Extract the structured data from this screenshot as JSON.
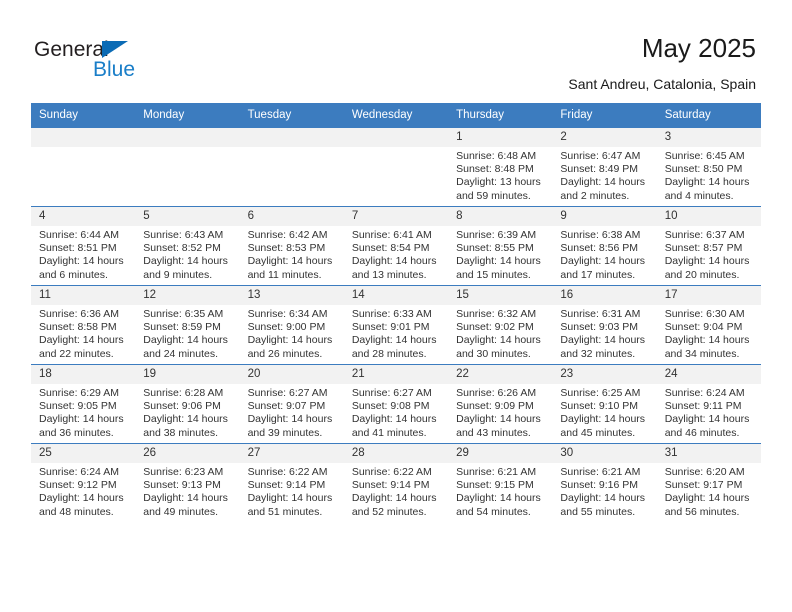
{
  "brand": {
    "name_part1": "General",
    "name_part2": "Blue",
    "triangle_icon": "triangle-icon",
    "accent_color": "#1a7ec8"
  },
  "header": {
    "title": "May 2025",
    "subtitle": "Sant Andreu, Catalonia, Spain",
    "header_bg_color": "#3c7cbf"
  },
  "weekday_headers": [
    "Sunday",
    "Monday",
    "Tuesday",
    "Wednesday",
    "Thursday",
    "Friday",
    "Saturday"
  ],
  "weeks": [
    [
      {
        "day": "",
        "sunrise": "",
        "sunset": "",
        "daylight_line1": "",
        "daylight_line2": "",
        "empty": true
      },
      {
        "day": "",
        "sunrise": "",
        "sunset": "",
        "daylight_line1": "",
        "daylight_line2": "",
        "empty": true
      },
      {
        "day": "",
        "sunrise": "",
        "sunset": "",
        "daylight_line1": "",
        "daylight_line2": "",
        "empty": true
      },
      {
        "day": "",
        "sunrise": "",
        "sunset": "",
        "daylight_line1": "",
        "daylight_line2": "",
        "empty": true
      },
      {
        "day": "1",
        "sunrise": "Sunrise: 6:48 AM",
        "sunset": "Sunset: 8:48 PM",
        "daylight_line1": "Daylight: 13 hours",
        "daylight_line2": "and 59 minutes.",
        "empty": false
      },
      {
        "day": "2",
        "sunrise": "Sunrise: 6:47 AM",
        "sunset": "Sunset: 8:49 PM",
        "daylight_line1": "Daylight: 14 hours",
        "daylight_line2": "and 2 minutes.",
        "empty": false
      },
      {
        "day": "3",
        "sunrise": "Sunrise: 6:45 AM",
        "sunset": "Sunset: 8:50 PM",
        "daylight_line1": "Daylight: 14 hours",
        "daylight_line2": "and 4 minutes.",
        "empty": false
      }
    ],
    [
      {
        "day": "4",
        "sunrise": "Sunrise: 6:44 AM",
        "sunset": "Sunset: 8:51 PM",
        "daylight_line1": "Daylight: 14 hours",
        "daylight_line2": "and 6 minutes.",
        "empty": false
      },
      {
        "day": "5",
        "sunrise": "Sunrise: 6:43 AM",
        "sunset": "Sunset: 8:52 PM",
        "daylight_line1": "Daylight: 14 hours",
        "daylight_line2": "and 9 minutes.",
        "empty": false
      },
      {
        "day": "6",
        "sunrise": "Sunrise: 6:42 AM",
        "sunset": "Sunset: 8:53 PM",
        "daylight_line1": "Daylight: 14 hours",
        "daylight_line2": "and 11 minutes.",
        "empty": false
      },
      {
        "day": "7",
        "sunrise": "Sunrise: 6:41 AM",
        "sunset": "Sunset: 8:54 PM",
        "daylight_line1": "Daylight: 14 hours",
        "daylight_line2": "and 13 minutes.",
        "empty": false
      },
      {
        "day": "8",
        "sunrise": "Sunrise: 6:39 AM",
        "sunset": "Sunset: 8:55 PM",
        "daylight_line1": "Daylight: 14 hours",
        "daylight_line2": "and 15 minutes.",
        "empty": false
      },
      {
        "day": "9",
        "sunrise": "Sunrise: 6:38 AM",
        "sunset": "Sunset: 8:56 PM",
        "daylight_line1": "Daylight: 14 hours",
        "daylight_line2": "and 17 minutes.",
        "empty": false
      },
      {
        "day": "10",
        "sunrise": "Sunrise: 6:37 AM",
        "sunset": "Sunset: 8:57 PM",
        "daylight_line1": "Daylight: 14 hours",
        "daylight_line2": "and 20 minutes.",
        "empty": false
      }
    ],
    [
      {
        "day": "11",
        "sunrise": "Sunrise: 6:36 AM",
        "sunset": "Sunset: 8:58 PM",
        "daylight_line1": "Daylight: 14 hours",
        "daylight_line2": "and 22 minutes.",
        "empty": false
      },
      {
        "day": "12",
        "sunrise": "Sunrise: 6:35 AM",
        "sunset": "Sunset: 8:59 PM",
        "daylight_line1": "Daylight: 14 hours",
        "daylight_line2": "and 24 minutes.",
        "empty": false
      },
      {
        "day": "13",
        "sunrise": "Sunrise: 6:34 AM",
        "sunset": "Sunset: 9:00 PM",
        "daylight_line1": "Daylight: 14 hours",
        "daylight_line2": "and 26 minutes.",
        "empty": false
      },
      {
        "day": "14",
        "sunrise": "Sunrise: 6:33 AM",
        "sunset": "Sunset: 9:01 PM",
        "daylight_line1": "Daylight: 14 hours",
        "daylight_line2": "and 28 minutes.",
        "empty": false
      },
      {
        "day": "15",
        "sunrise": "Sunrise: 6:32 AM",
        "sunset": "Sunset: 9:02 PM",
        "daylight_line1": "Daylight: 14 hours",
        "daylight_line2": "and 30 minutes.",
        "empty": false
      },
      {
        "day": "16",
        "sunrise": "Sunrise: 6:31 AM",
        "sunset": "Sunset: 9:03 PM",
        "daylight_line1": "Daylight: 14 hours",
        "daylight_line2": "and 32 minutes.",
        "empty": false
      },
      {
        "day": "17",
        "sunrise": "Sunrise: 6:30 AM",
        "sunset": "Sunset: 9:04 PM",
        "daylight_line1": "Daylight: 14 hours",
        "daylight_line2": "and 34 minutes.",
        "empty": false
      }
    ],
    [
      {
        "day": "18",
        "sunrise": "Sunrise: 6:29 AM",
        "sunset": "Sunset: 9:05 PM",
        "daylight_line1": "Daylight: 14 hours",
        "daylight_line2": "and 36 minutes.",
        "empty": false
      },
      {
        "day": "19",
        "sunrise": "Sunrise: 6:28 AM",
        "sunset": "Sunset: 9:06 PM",
        "daylight_line1": "Daylight: 14 hours",
        "daylight_line2": "and 38 minutes.",
        "empty": false
      },
      {
        "day": "20",
        "sunrise": "Sunrise: 6:27 AM",
        "sunset": "Sunset: 9:07 PM",
        "daylight_line1": "Daylight: 14 hours",
        "daylight_line2": "and 39 minutes.",
        "empty": false
      },
      {
        "day": "21",
        "sunrise": "Sunrise: 6:27 AM",
        "sunset": "Sunset: 9:08 PM",
        "daylight_line1": "Daylight: 14 hours",
        "daylight_line2": "and 41 minutes.",
        "empty": false
      },
      {
        "day": "22",
        "sunrise": "Sunrise: 6:26 AM",
        "sunset": "Sunset: 9:09 PM",
        "daylight_line1": "Daylight: 14 hours",
        "daylight_line2": "and 43 minutes.",
        "empty": false
      },
      {
        "day": "23",
        "sunrise": "Sunrise: 6:25 AM",
        "sunset": "Sunset: 9:10 PM",
        "daylight_line1": "Daylight: 14 hours",
        "daylight_line2": "and 45 minutes.",
        "empty": false
      },
      {
        "day": "24",
        "sunrise": "Sunrise: 6:24 AM",
        "sunset": "Sunset: 9:11 PM",
        "daylight_line1": "Daylight: 14 hours",
        "daylight_line2": "and 46 minutes.",
        "empty": false
      }
    ],
    [
      {
        "day": "25",
        "sunrise": "Sunrise: 6:24 AM",
        "sunset": "Sunset: 9:12 PM",
        "daylight_line1": "Daylight: 14 hours",
        "daylight_line2": "and 48 minutes.",
        "empty": false
      },
      {
        "day": "26",
        "sunrise": "Sunrise: 6:23 AM",
        "sunset": "Sunset: 9:13 PM",
        "daylight_line1": "Daylight: 14 hours",
        "daylight_line2": "and 49 minutes.",
        "empty": false
      },
      {
        "day": "27",
        "sunrise": "Sunrise: 6:22 AM",
        "sunset": "Sunset: 9:14 PM",
        "daylight_line1": "Daylight: 14 hours",
        "daylight_line2": "and 51 minutes.",
        "empty": false
      },
      {
        "day": "28",
        "sunrise": "Sunrise: 6:22 AM",
        "sunset": "Sunset: 9:14 PM",
        "daylight_line1": "Daylight: 14 hours",
        "daylight_line2": "and 52 minutes.",
        "empty": false
      },
      {
        "day": "29",
        "sunrise": "Sunrise: 6:21 AM",
        "sunset": "Sunset: 9:15 PM",
        "daylight_line1": "Daylight: 14 hours",
        "daylight_line2": "and 54 minutes.",
        "empty": false
      },
      {
        "day": "30",
        "sunrise": "Sunrise: 6:21 AM",
        "sunset": "Sunset: 9:16 PM",
        "daylight_line1": "Daylight: 14 hours",
        "daylight_line2": "and 55 minutes.",
        "empty": false
      },
      {
        "day": "31",
        "sunrise": "Sunrise: 6:20 AM",
        "sunset": "Sunset: 9:17 PM",
        "daylight_line1": "Daylight: 14 hours",
        "daylight_line2": "and 56 minutes.",
        "empty": false
      }
    ]
  ]
}
